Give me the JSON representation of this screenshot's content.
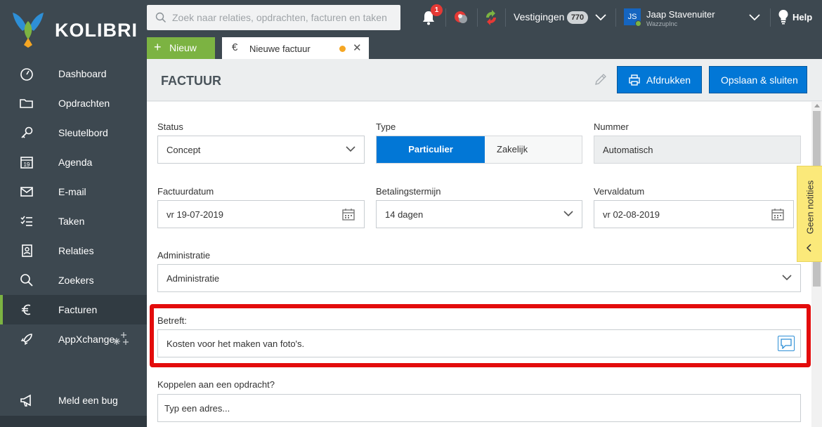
{
  "app": {
    "brand": "KOLIBRI",
    "colors": {
      "sidebar": "#3d4850",
      "accent_green": "#7cb342",
      "primary_blue": "#0277d6",
      "highlight_red": "#e30c0c",
      "notes_yellow": "#fbe97a"
    }
  },
  "search": {
    "placeholder": "Zoek naar relaties, opdrachten, facturen en taken"
  },
  "topbar": {
    "notifications_count": "1",
    "vestigingen_label": "Vestigingen",
    "vestigingen_count": "770",
    "user_initials": "JS",
    "user_name": "Jaap Stavenuiter",
    "user_company": "WazzupInc",
    "help_label": "Help"
  },
  "sidebar": {
    "items": [
      {
        "label": "Dashboard",
        "icon": "gauge-icon"
      },
      {
        "label": "Opdrachten",
        "icon": "folder-icon"
      },
      {
        "label": "Sleutelbord",
        "icon": "key-icon"
      },
      {
        "label": "Agenda",
        "icon": "calendar-icon",
        "icon_text": "19"
      },
      {
        "label": "E-mail",
        "icon": "envelope-icon"
      },
      {
        "label": "Taken",
        "icon": "checklist-icon"
      },
      {
        "label": "Relaties",
        "icon": "contact-card-icon"
      },
      {
        "label": "Zoekers",
        "icon": "search-icon"
      },
      {
        "label": "Facturen",
        "icon": "euro-icon",
        "active": true
      },
      {
        "label": "AppXchange",
        "icon": "rocket-icon"
      }
    ],
    "bottom": {
      "label": "Meld een bug",
      "icon": "megaphone-icon"
    }
  },
  "tabs": {
    "new_label": "Nieuw",
    "open_tab_label": "Nieuwe factuur"
  },
  "header": {
    "title": "FACTUUR",
    "print_label": "Afdrukken",
    "save_label": "Opslaan & sluiten"
  },
  "form": {
    "status": {
      "label": "Status",
      "value": "Concept"
    },
    "type": {
      "label": "Type",
      "options": [
        "Particulier",
        "Zakelijk"
      ],
      "selected": "Particulier"
    },
    "nummer": {
      "label": "Nummer",
      "value": "Automatisch"
    },
    "factuurdatum": {
      "label": "Factuurdatum",
      "value": "vr 19-07-2019"
    },
    "betalingstermijn": {
      "label": "Betalingstermijn",
      "value": "14 dagen"
    },
    "vervaldatum": {
      "label": "Vervaldatum",
      "value": "vr 02-08-2019"
    },
    "administratie": {
      "label": "Administratie",
      "value": "Administratie"
    },
    "betreft": {
      "label": "Betreft:",
      "value": "Kosten voor het maken van foto's."
    },
    "koppelen": {
      "label": "Koppelen aan een opdracht?",
      "placeholder": "Typ een adres..."
    }
  },
  "notes": {
    "label": "Geen notities"
  }
}
